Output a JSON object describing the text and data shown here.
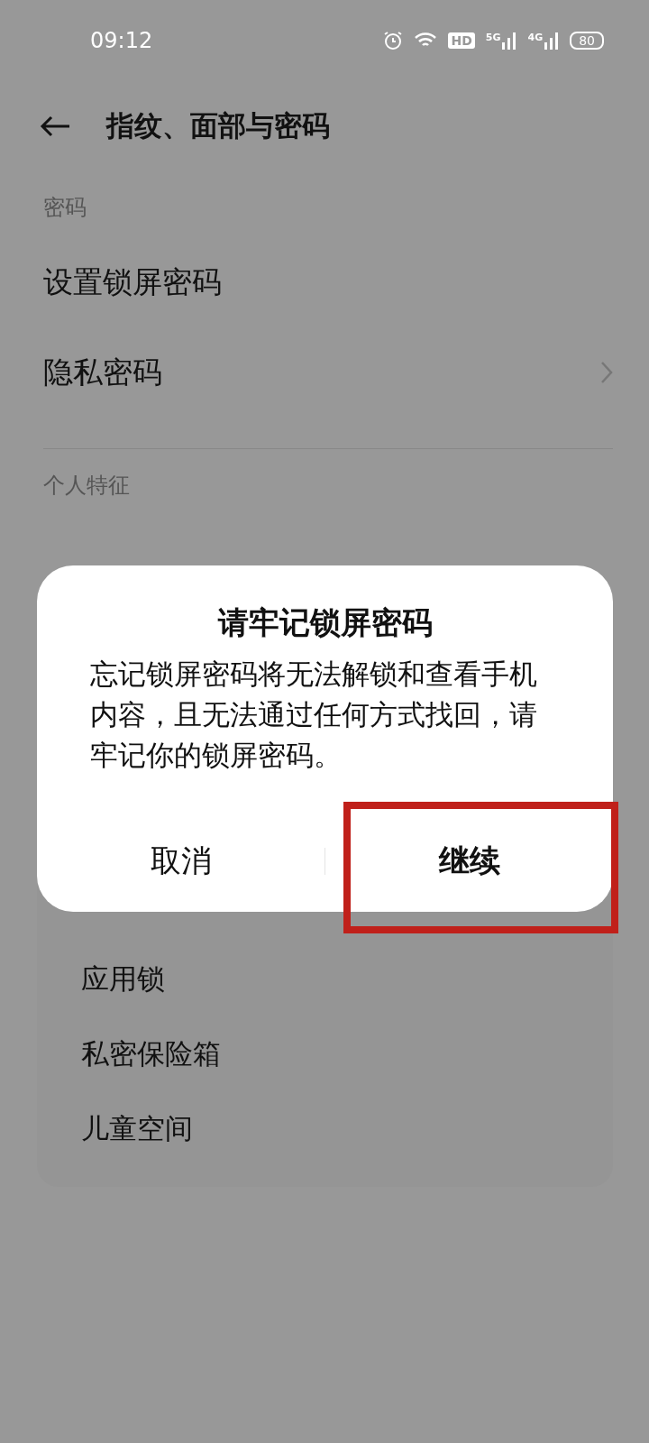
{
  "status_bar": {
    "time": "09:12",
    "hd": "HD",
    "signals": [
      {
        "label": "5G"
      },
      {
        "label": "4G"
      }
    ],
    "battery": "80"
  },
  "header": {
    "title": "指纹、面部与密码"
  },
  "sections": [
    {
      "title": "密码",
      "items": [
        {
          "label": "设置锁屏密码",
          "chevron": false
        },
        {
          "label": "隐私密码",
          "chevron": true
        }
      ]
    },
    {
      "title": "个人特征"
    }
  ],
  "suggestions": {
    "items": [
      "应用锁",
      "私密保险箱",
      "儿童空间"
    ]
  },
  "dialog": {
    "title": "请牢记锁屏密码",
    "message": "忘记锁屏密码将无法解锁和查看手机内容，且无法通过任何方式找回，请牢记你的锁屏密码。",
    "buttons": [
      {
        "label": "取消",
        "primary": false
      },
      {
        "label": "继续",
        "primary": true
      }
    ]
  }
}
